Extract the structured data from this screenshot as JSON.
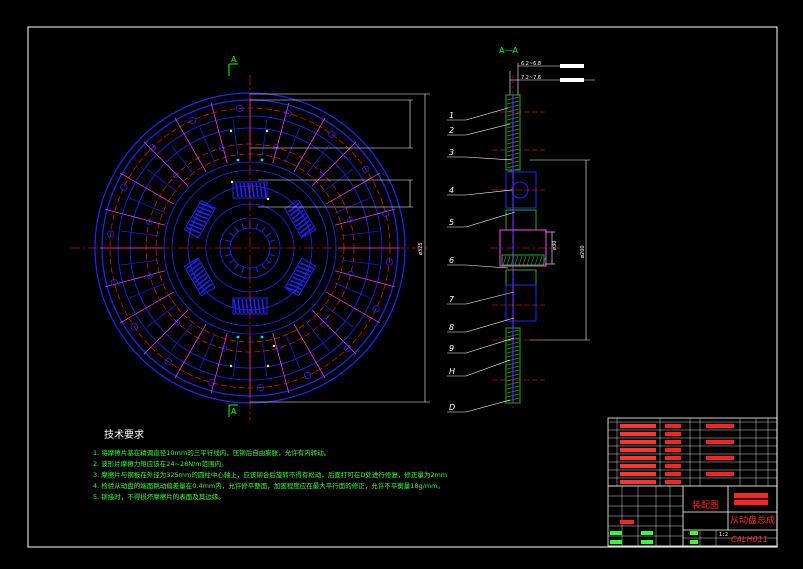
{
  "section_label": "A—A",
  "section_marks": [
    "A",
    "A"
  ],
  "tech_requirements": {
    "title": "技术要求",
    "items": [
      "1. 将摩擦片基在精调直径10mm的三平行线内，压铆后自由膨胀，允许有内转动。",
      "2. 波形片摩擦力矩应该在24~28N/m范围内。",
      "3. 摩擦片与钢板在外径为325mm的圆柱中心轴上，应该铆合后旋转不得有松动，后面打可在D处进行修复，修正量为2mm",
      "4. 检验从动盘的端面跳动偏差量在0.4mm内，允许修平整面，加固程度应在最大平行面的修正，允许不平衡量18g/mm。",
      "5. 铆接时，不得损坏摩擦片的表面及其边缘。"
    ]
  },
  "part_labels": [
    "1",
    "2",
    "3",
    "4",
    "5",
    "6",
    "7",
    "8",
    "9",
    "H",
    "D"
  ],
  "dimensions": {
    "top1": "6.2~6.8",
    "top2": "7.2~7.6",
    "outer_dia": "ø325",
    "hub_dia": "ø30",
    "right_dia": "ø200"
  },
  "title_block": {
    "assembly_title": "装配图",
    "drawing_name": "从动盘总成",
    "drawing_code": "CALH011",
    "scale": "1:2"
  },
  "colors": {
    "background": "#000000",
    "frame": "#ffffff",
    "part_blue": "#2222ff",
    "center_red": "#ff2222",
    "text_green": "#33ff33",
    "magenta": "#ff44ff",
    "cyan": "#00e5e5",
    "yellow": "#ffff00"
  }
}
